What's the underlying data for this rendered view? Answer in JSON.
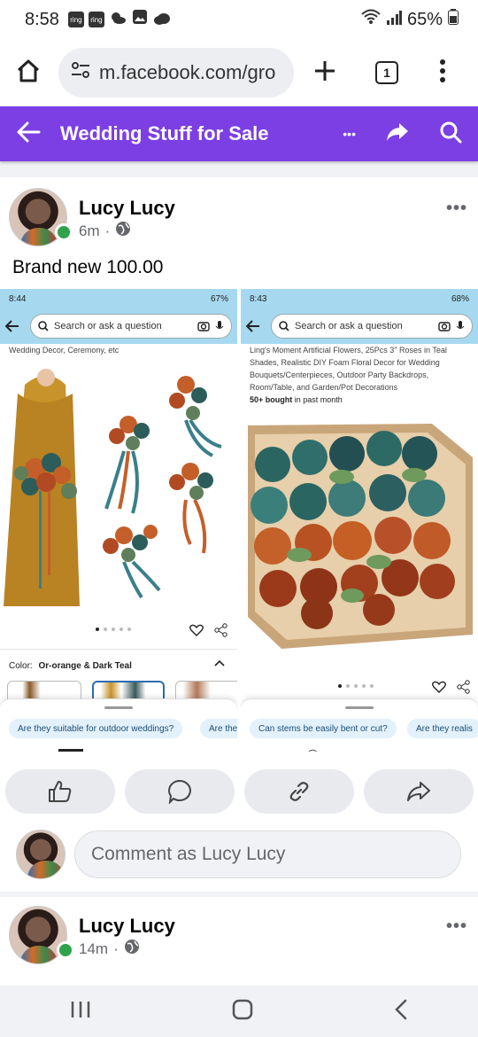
{
  "status_bar": {
    "time": "8:58",
    "notif_icons": [
      "ring",
      "ring"
    ],
    "battery": "65%"
  },
  "browser": {
    "url": "m.facebook.com/gro",
    "tab_count": "1"
  },
  "group": {
    "title": "Wedding Stuff for Sale",
    "more_label": "•••"
  },
  "posts": [
    {
      "author": "Lucy Lucy",
      "time": "6m",
      "body": "Brand new 100.00",
      "comment_placeholder": "Comment as Lucy Lucy"
    },
    {
      "author": "Lucy Lucy",
      "time": "14m"
    }
  ],
  "screenshot_left": {
    "time": "8:44",
    "battery": "67%",
    "search_placeholder": "Search or ask a question",
    "caption": "Wedding Decor, Ceremony, etc",
    "color_label": "Color:",
    "color_value": "Or-orange & Dark Teal",
    "chips": [
      "Are they suitable for outdoor weddings?",
      "Are the"
    ]
  },
  "screenshot_right": {
    "time": "8:43",
    "battery": "68%",
    "search_placeholder": "Search or ask a question",
    "product_desc": "Ling's Moment Artificial Flowers, 25Pcs 3\" Roses in Teal Shades, Realistic DIY Foam Floral Decor for Wedding Bouquets/Centerpieces, Outdoor Party Backdrops, Room/Table, and Garden/Pot Decorations",
    "bought_bold": "50+ bought",
    "bought_rest": " in past month",
    "chips": [
      "Can stems be easily bent or cut?",
      "Are they realis"
    ]
  },
  "icons": {
    "home": "home-icon",
    "tabs": "tabs-icon",
    "add": "plus-icon",
    "menu": "kebab-menu-icon",
    "back": "arrow-left-icon",
    "share": "share-icon",
    "search": "search-icon",
    "like": "thumbs-up-icon",
    "comment": "comment-icon",
    "link": "link-icon",
    "globe": "globe-icon"
  },
  "colors": {
    "group_header": "#7b3fe4",
    "online": "#31a24c",
    "amazon_header": "#a6d9f0"
  }
}
